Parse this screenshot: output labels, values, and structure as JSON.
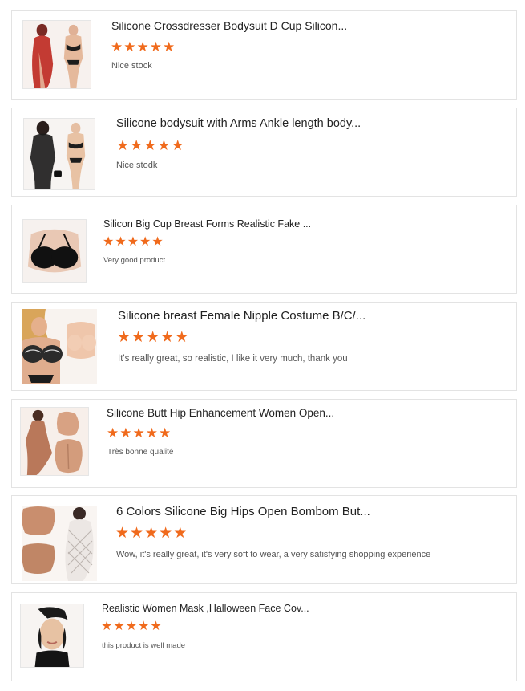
{
  "theme": {
    "star_color": "#f06a1c",
    "border_color": "#e3e3e3"
  },
  "reviews": [
    {
      "title": "Silicone Crossdresser Bodysuit D Cup Silicon...",
      "rating": 5,
      "star_icon": "star-icon",
      "text": "Nice stock",
      "image_icon": "product-bodysuit-red-dress-image"
    },
    {
      "title": "Silicone bodysuit with Arms Ankle length body...",
      "rating": 5,
      "star_icon": "star-icon",
      "text": "Nice stodk",
      "image_icon": "product-bodysuit-black-mesh-image"
    },
    {
      "title": "Silicon Big Cup Breast Forms Realistic Fake ...",
      "rating": 5,
      "star_icon": "star-icon",
      "text": "Very good product",
      "image_icon": "product-breast-forms-black-bra-image"
    },
    {
      "title": "Silicone breast Female Nipple Costume B/C/...",
      "rating": 5,
      "star_icon": "star-icon",
      "text": "It's really great, so realistic, I like it very much, thank you",
      "image_icon": "product-breast-form-lace-bra-image"
    },
    {
      "title": "Silicone Butt Hip Enhancement Women Open...",
      "rating": 5,
      "star_icon": "star-icon",
      "text": "Très bonne qualité",
      "image_icon": "product-hip-pads-image"
    },
    {
      "title": "6 Colors Silicone Big Hips Open Bombom But...",
      "rating": 5,
      "star_icon": "star-icon",
      "text": "Wow, it's really great, it's very soft to wear, a very satisfying shopping experience",
      "image_icon": "product-big-hips-white-fishnet-image"
    },
    {
      "title": "Realistic Women Mask ,Halloween Face Cov...",
      "rating": 5,
      "star_icon": "star-icon",
      "text": "this product is well made",
      "image_icon": "product-face-mask-image"
    }
  ]
}
